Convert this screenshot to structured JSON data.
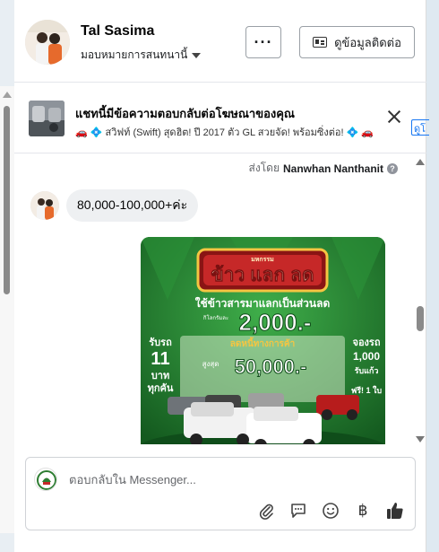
{
  "header": {
    "contact_name": "Tal Sasima",
    "assign_label": "มอบหมายการสนทนานี้",
    "more_label": "···",
    "contact_info_label": "ดูข้อมูลติดต่อ"
  },
  "ad_banner": {
    "title": "แชทนี้มีข้อความตอบกลับต่อโฆษณาของคุณ",
    "preview": "🚗 💠 สวิฟท์ (Swift) สุดฮิต! ปี 2017 ตัว GL สวยจัด! พร้อมซิ่งต่อ! 💠 🚗",
    "link_label": "ดูโ"
  },
  "thread": {
    "sent_by_prefix": "ส่งโดย",
    "sent_by_name": "Nanwhan Nanthanit",
    "message_text": "80,000-100,000+ค่ะ"
  },
  "promo_image": {
    "badge": "มหกรรม",
    "headline": "ข้าว แลก ลด",
    "subtitle": "ใช้ข้าวสารมาแลกเป็นส่วนลด",
    "amount_prefix": "กิโลกรัมละ",
    "amount": "2,000.-",
    "mid_text": "ลดหนี้ทางการค้า",
    "max_prefix": "สูงสุด",
    "max_amount": "50,000.-",
    "left_line1": "รับรถ",
    "left_line2": "11",
    "left_line3": "บาท",
    "left_line4": "ทุกคัน",
    "right_line1": "จองรถ",
    "right_line2": "1,000",
    "right_line3": "รับแก้ว",
    "right_line4": "ฟรี! 1 ใบ"
  },
  "composer": {
    "placeholder": "ตอบกลับใน Messenger..."
  },
  "colors": {
    "accent_link": "#1877f2",
    "promo_green": "#1f7a2c",
    "promo_gold": "#f5c542",
    "promo_red": "#c62828"
  },
  "icons": [
    "caret-down-icon",
    "contact-card-icon",
    "close-icon",
    "help-icon",
    "attach-icon",
    "saved-reply-icon",
    "emoji-icon",
    "baht-icon",
    "thumbs-up-icon"
  ]
}
